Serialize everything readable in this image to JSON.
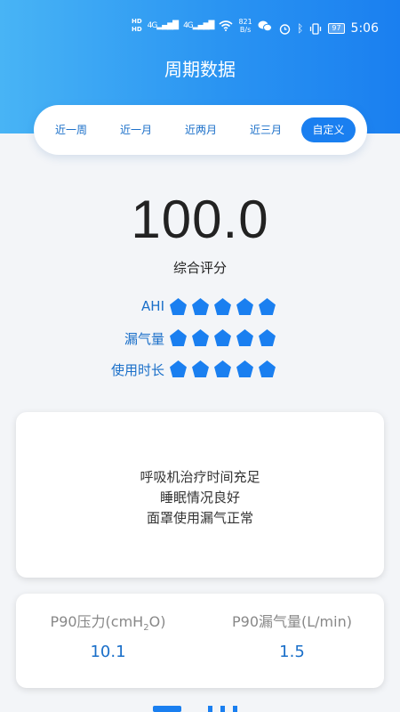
{
  "status_bar": {
    "hd1": "HD",
    "hd2": "HD",
    "signal1": "4G",
    "signal2": "4G",
    "speed_value": "821",
    "speed_unit": "B/s",
    "battery": "97",
    "time": "5:06"
  },
  "page": {
    "title": "周期数据"
  },
  "tabs": [
    {
      "label": "近一周",
      "active": false
    },
    {
      "label": "近一月",
      "active": false
    },
    {
      "label": "近两月",
      "active": false
    },
    {
      "label": "近三月",
      "active": false
    },
    {
      "label": "自定义",
      "active": true
    }
  ],
  "score": {
    "value": "100.0",
    "label": "综合评分"
  },
  "metrics": [
    {
      "label": "AHI",
      "rating": 5,
      "max": 5
    },
    {
      "label": "漏气量",
      "rating": 5,
      "max": 5
    },
    {
      "label": "使用时长",
      "rating": 5,
      "max": 5
    }
  ],
  "summary": {
    "lines": [
      "呼吸机治疗时间充足",
      "睡眠情况良好",
      "面罩使用漏气正常"
    ]
  },
  "stats": {
    "p90_pressure": {
      "label_main": "P90压力(cmH",
      "label_sub": "2",
      "label_end": "O)",
      "value": "10.1"
    },
    "p90_leak": {
      "label": "P90漏气量(L/min)",
      "value": "1.5"
    }
  },
  "colors": {
    "primary": "#1a7ff0",
    "accent_text": "#1a6fc9",
    "background": "#f3f5f8"
  }
}
